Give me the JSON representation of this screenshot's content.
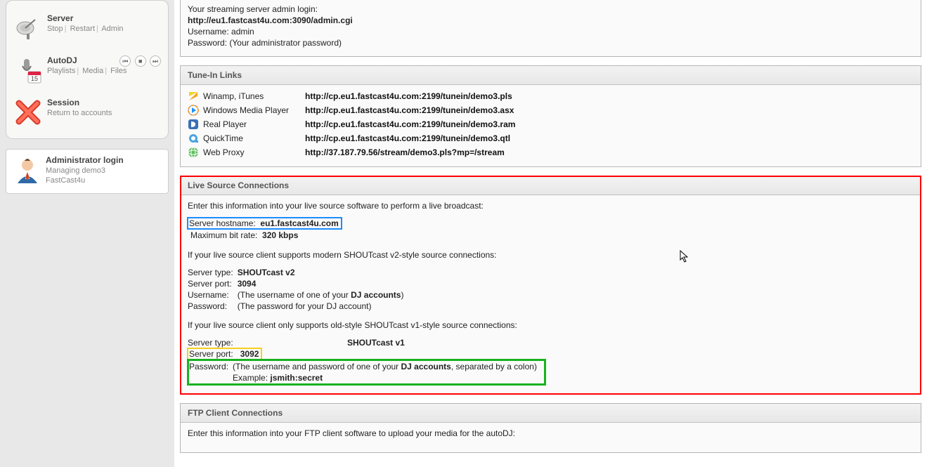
{
  "sidebar": {
    "server": {
      "title": "Server",
      "links": [
        "Stop",
        "Restart",
        "Admin"
      ]
    },
    "autodj": {
      "title": "AutoDJ",
      "links": [
        "Playlists",
        "Media",
        "Files"
      ]
    },
    "session": {
      "title": "Session",
      "sub": "Return to accounts"
    },
    "admin": {
      "title": "Administrator login",
      "line1": "Managing demo3",
      "line2": "FastCast4u"
    }
  },
  "top_panel": {
    "intro": "Your streaming server admin login:",
    "admin_url": "http://eu1.fastcast4u.com:3090/admin.cgi",
    "username_lbl": "Username:",
    "username_val": "admin",
    "password_lbl": "Password:",
    "password_val": "(Your administrator password)"
  },
  "tunein": {
    "title": "Tune-In Links",
    "rows": [
      {
        "name": "Winamp, iTunes",
        "url": "http://cp.eu1.fastcast4u.com:2199/tunein/demo3.pls"
      },
      {
        "name": "Windows Media Player",
        "url": "http://cp.eu1.fastcast4u.com:2199/tunein/demo3.asx"
      },
      {
        "name": "Real Player",
        "url": "http://cp.eu1.fastcast4u.com:2199/tunein/demo3.ram"
      },
      {
        "name": "QuickTime",
        "url": "http://cp.eu1.fastcast4u.com:2199/tunein/demo3.qtl"
      },
      {
        "name": "Web Proxy",
        "url": "http://37.187.79.56/stream/demo3.pls?mp=/stream"
      }
    ]
  },
  "live": {
    "title": "Live Source Connections",
    "intro": "Enter this information into your live source software to perform a live broadcast:",
    "hostname_lbl": "Server hostname:",
    "hostname_val": "eu1.fastcast4u.com",
    "bitrate_lbl": "Maximum bit rate:",
    "bitrate_val": "320 kbps",
    "v2_note": "If your live source client supports modern SHOUTcast v2-style source connections:",
    "v2": {
      "type_lbl": "Server type:",
      "type_val": "SHOUTcast v2",
      "port_lbl": "Server port:",
      "port_val": "3094",
      "user_lbl": "Username:",
      "user_val_pre": "(The username of one of your ",
      "user_val_bold": "DJ accounts",
      "user_val_post": ")",
      "pass_lbl": "Password:",
      "pass_val": "(The password for your DJ account)"
    },
    "v1_note": "If your live source client only supports old-style SHOUTcast v1-style source connections:",
    "v1": {
      "type_lbl": "Server type:",
      "type_val": "SHOUTcast v1",
      "port_lbl": "Server port:",
      "port_val": "3092",
      "pass_lbl": "Password:",
      "pass_val_pre": "(The username and password of one of your ",
      "pass_val_bold": "DJ accounts",
      "pass_val_post": ", separated by a colon)",
      "example_lbl": "Example:",
      "example_val": "jsmith:secret"
    }
  },
  "ftp": {
    "title": "FTP Client Connections",
    "intro": "Enter this information into your FTP client software to upload your media for the autoDJ:"
  }
}
